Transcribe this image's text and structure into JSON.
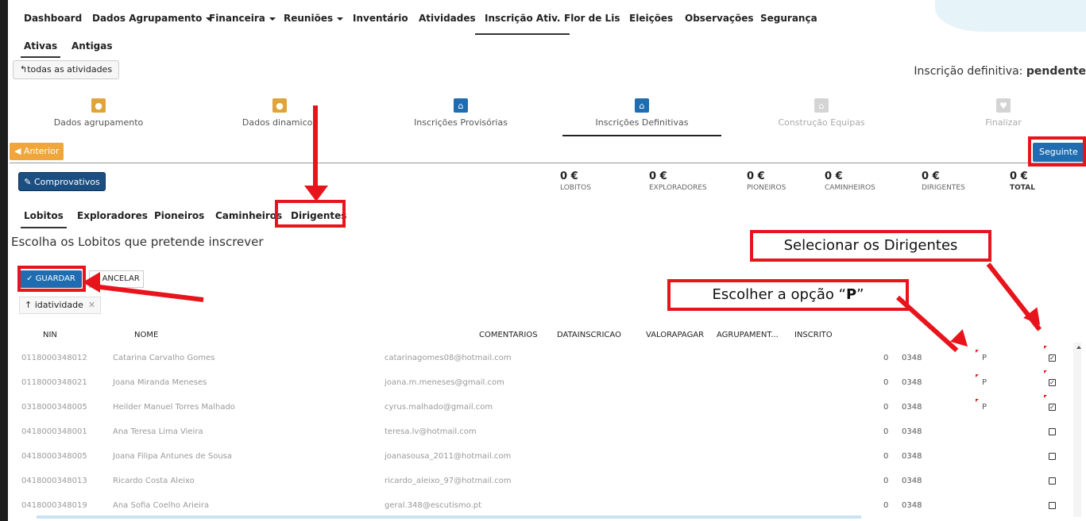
{
  "nav": {
    "items": [
      {
        "label": "Dashboard"
      },
      {
        "label": "Dados Agrupamento",
        "dropdown": true
      },
      {
        "label": "Financeira",
        "dropdown": true
      },
      {
        "label": "Reuniões",
        "dropdown": true
      },
      {
        "label": "Inventário"
      },
      {
        "label": "Atividades"
      },
      {
        "label": "Inscrição Ativ.",
        "active": true
      },
      {
        "label": "Flor de Lis"
      },
      {
        "label": "Eleições"
      },
      {
        "label": "Observações"
      },
      {
        "label": "Segurança"
      }
    ]
  },
  "subnav": {
    "active": "Ativas",
    "other": "Antigas"
  },
  "back_button": "todas as atividades",
  "inscricao_status": {
    "label": "Inscrição definitiva:",
    "value": "pendente"
  },
  "wizard": {
    "steps": [
      {
        "label": "Dados agrupamento",
        "icon": "user-icon",
        "color": "#e0a43a"
      },
      {
        "label": "Dados dinamicos",
        "icon": "user-icon",
        "color": "#e0a43a"
      },
      {
        "label": "Inscrições Provisórias",
        "icon": "home-icon",
        "color": "#1f6db0"
      },
      {
        "label": "Inscrições Definitivas",
        "icon": "home-icon",
        "color": "#1f6db0",
        "active": true
      },
      {
        "label": "Construção Equipas",
        "icon": "home-icon",
        "color": "#d4d4d4",
        "disabled": true
      },
      {
        "label": "Finalizar",
        "icon": "heart-icon",
        "color": "#d4d4d4",
        "disabled": true
      }
    ]
  },
  "prev_button": "Anterior",
  "next_button": "Seguinte",
  "comprovativos_button": "Comprovativos",
  "totals": [
    {
      "value": "0 €",
      "label": "LOBITOS"
    },
    {
      "value": "0 €",
      "label": "EXPLORADORES"
    },
    {
      "value": "0 €",
      "label": "PIONEIROS"
    },
    {
      "value": "0 €",
      "label": "CAMINHEIROS"
    },
    {
      "value": "0 €",
      "label": "DIRIGENTES"
    },
    {
      "value": "0 €",
      "label": "TOTAL"
    }
  ],
  "tabs": [
    "Lobitos",
    "Exploradores",
    "Pioneiros",
    "Caminheiros",
    "Dirigentes"
  ],
  "heading": "Escolha os Lobitos que pretende inscrever",
  "save_button": "GUARDAR",
  "cancel_button": "ANCELAR",
  "sort_chip": "idatividade",
  "columns": [
    "NIN",
    "NOME",
    "COMENTARIOS",
    "DATAINSCRICAO",
    "VALORAPAGAR",
    "AGRUPAMENT...",
    "INSCRITO"
  ],
  "rows": [
    {
      "nin": "0118000348012",
      "nome": "Catarina Carvalho Gomes",
      "email": "catarinagomes08@hotmail.com",
      "valor": "0",
      "agrup": "0348",
      "p": "P",
      "checked": true
    },
    {
      "nin": "0118000348021",
      "nome": "Joana Miranda Meneses",
      "email": "joana.m.meneses@gmail.com",
      "valor": "0",
      "agrup": "0348",
      "p": "P",
      "checked": true
    },
    {
      "nin": "0318000348005",
      "nome": "Heilder Manuel Torres Malhado",
      "email": "cyrus.malhado@gmail.com",
      "valor": "0",
      "agrup": "0348",
      "p": "P",
      "checked": true
    },
    {
      "nin": "0418000348001",
      "nome": "Ana Teresa Lima Vieira",
      "email": "teresa.lv@hotmail.com",
      "valor": "0",
      "agrup": "0348",
      "p": "",
      "checked": false
    },
    {
      "nin": "0418000348005",
      "nome": "Joana Filipa Antunes de Sousa",
      "email": "joanasousa_2011@hotmail.com",
      "valor": "0",
      "agrup": "0348",
      "p": "",
      "checked": false
    },
    {
      "nin": "0418000348013",
      "nome": "Ricardo Costa Aleixo",
      "email": "ricardo_aleixo_97@hotmail.com",
      "valor": "0",
      "agrup": "0348",
      "p": "",
      "checked": false
    },
    {
      "nin": "0418000348019",
      "nome": "Ana Sofia Coelho Arieira",
      "email": "geral.348@escutismo.pt",
      "valor": "0",
      "agrup": "0348",
      "p": "",
      "checked": false
    }
  ],
  "callouts": {
    "select_dirigentes": "Selecionar os Dirigentes",
    "choose_p_prefix": "Escolher a opção “",
    "choose_p_bold": "P",
    "choose_p_suffix": "”"
  },
  "colors": {
    "accent_blue": "#1f6db0",
    "accent_orange": "#f0a63a",
    "annotation_red": "#e8141c"
  }
}
